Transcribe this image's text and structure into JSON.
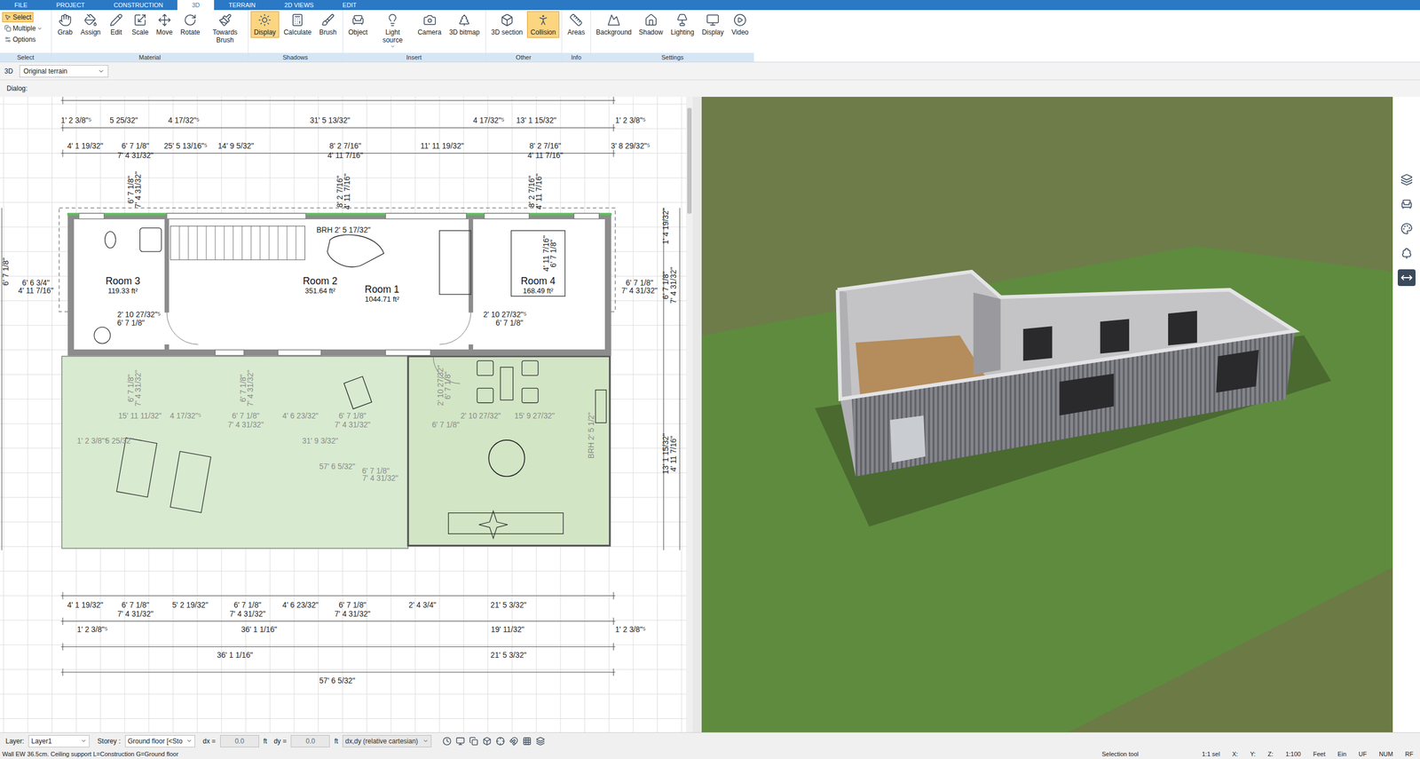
{
  "tabs": [
    {
      "label": "FILE",
      "selected": false
    },
    {
      "label": "PROJECT",
      "selected": false
    },
    {
      "label": "CONSTRUCTION",
      "selected": false
    },
    {
      "label": "3D",
      "selected": true
    },
    {
      "label": "TERRAIN",
      "selected": false
    },
    {
      "label": "2D VIEWS",
      "selected": false
    },
    {
      "label": "EDIT",
      "selected": false
    }
  ],
  "ribbon": {
    "select_group": {
      "label": "Select",
      "items": [
        {
          "label": "Select",
          "selected": true
        },
        {
          "label": "Multiple",
          "selected": false
        },
        {
          "label": "Options",
          "selected": false
        }
      ]
    },
    "groups": [
      {
        "label": "Material",
        "items": [
          {
            "label": "Grab",
            "selected": false
          },
          {
            "label": "Assign",
            "selected": false
          },
          {
            "label": "Edit",
            "selected": false
          },
          {
            "label": "Scale",
            "selected": false
          },
          {
            "label": "Move",
            "selected": false
          },
          {
            "label": "Rotate",
            "selected": false
          },
          {
            "label": "Towards Brush",
            "selected": false
          }
        ]
      },
      {
        "label": "Shadows",
        "items": [
          {
            "label": "Display",
            "selected": true
          },
          {
            "label": "Calculate",
            "selected": false
          },
          {
            "label": "Brush",
            "selected": false
          }
        ]
      },
      {
        "label": "Insert",
        "items": [
          {
            "label": "Object",
            "selected": false
          },
          {
            "label": "Light source",
            "selected": false
          },
          {
            "label": "Camera",
            "selected": false
          },
          {
            "label": "3D bitmap",
            "selected": false
          }
        ]
      },
      {
        "label": "Other",
        "items": [
          {
            "label": "3D section",
            "selected": false
          },
          {
            "label": "Collision",
            "selected": true
          }
        ]
      },
      {
        "label": "Info",
        "items": [
          {
            "label": "Areas",
            "selected": false
          }
        ]
      },
      {
        "label": "Settings",
        "items": [
          {
            "label": "Background",
            "selected": false
          },
          {
            "label": "Shadow",
            "selected": false
          },
          {
            "label": "Lighting",
            "selected": false
          },
          {
            "label": "Display",
            "selected": false
          },
          {
            "label": "Video",
            "selected": false
          }
        ]
      }
    ]
  },
  "view_bar": {
    "mode": "3D",
    "terrain": "Original terrain"
  },
  "dialog_label": "Dialog:",
  "plan": {
    "rooms": [
      {
        "name": "Room 3",
        "area": "119.33 ft²"
      },
      {
        "name": "Room 2",
        "area": "351.64 ft²"
      },
      {
        "name": "Room 1",
        "area": "1044.71 ft²"
      },
      {
        "name": "Room 4",
        "area": "168.49 ft²"
      }
    ],
    "dimensions": [
      {
        "text": "1' 2 3/8\"⁵",
        "muted": false
      },
      {
        "text": "5 25/32\"",
        "muted": false
      },
      {
        "text": "4 17/32\"⁵",
        "muted": false
      },
      {
        "text": "31' 5 13/32\"",
        "muted": false
      },
      {
        "text": "4 17/32\"⁵",
        "muted": false
      },
      {
        "text": "13' 1 15/32\"",
        "muted": false
      },
      {
        "text": "1' 2 3/8\"⁵",
        "muted": false
      },
      {
        "text": "4' 1 19/32\"",
        "muted": false
      },
      {
        "text": "6' 7 1/8\"",
        "muted": false
      },
      {
        "text": "25' 5 13/16\"⁵",
        "muted": false
      },
      {
        "text": "14' 9 5/32\"",
        "muted": false
      },
      {
        "text": "8' 2 7/16\"",
        "muted": false
      },
      {
        "text": "11' 11 19/32\"",
        "muted": false
      },
      {
        "text": "8' 2 7/16\"",
        "muted": false
      },
      {
        "text": "3' 8 29/32\"⁵",
        "muted": false
      },
      {
        "text": "7' 4 31/32\"",
        "muted": false
      },
      {
        "text": "4' 11 7/16\"",
        "muted": false
      },
      {
        "text": "4' 11 7/16\"",
        "muted": false
      },
      {
        "text": "2' 10 27/32\"⁵",
        "muted": false
      },
      {
        "text": "6' 7 1/8\"",
        "muted": false
      },
      {
        "text": "2' 10 27/32\"⁵",
        "muted": false
      },
      {
        "text": "6' 7 1/8\"",
        "muted": false
      },
      {
        "text": "6' 6 3/4\"",
        "muted": false
      },
      {
        "text": "4' 11 7/16\"",
        "muted": false
      },
      {
        "text": "6' 7 1/8\"",
        "muted": false
      },
      {
        "text": "7' 4 31/32\"",
        "muted": false
      },
      {
        "text": "15' 11 11/32\"",
        "muted": true
      },
      {
        "text": "4 17/32\"⁵",
        "muted": true
      },
      {
        "text": "6' 7 1/8\"",
        "muted": true
      },
      {
        "text": "7' 4 31/32\"",
        "muted": true
      },
      {
        "text": "4' 6 23/32\"",
        "muted": true
      },
      {
        "text": "6' 7 1/8\"",
        "muted": true
      },
      {
        "text": "7' 4 31/32\"",
        "muted": true
      },
      {
        "text": "6' 7 1/8\"",
        "muted": true
      },
      {
        "text": "2' 10 27/32\"",
        "muted": true
      },
      {
        "text": "15' 9 27/32\"",
        "muted": true
      },
      {
        "text": "1' 2 3/8\"⁵",
        "muted": true
      },
      {
        "text": "5 25/32\"",
        "muted": true
      },
      {
        "text": "31' 9 3/32\"",
        "muted": true
      },
      {
        "text": "57' 6 5/32\"",
        "muted": true
      },
      {
        "text": "6' 7 1/8\"",
        "muted": true
      },
      {
        "text": "7' 4 31/32\"",
        "muted": true
      },
      {
        "text": "4' 1 19/32\"",
        "muted": false
      },
      {
        "text": "6' 7 1/8\"",
        "muted": false
      },
      {
        "text": "5' 2 19/32\"",
        "muted": false
      },
      {
        "text": "6' 7 1/8\"",
        "muted": false
      },
      {
        "text": "4' 6 23/32\"",
        "muted": false
      },
      {
        "text": "6' 7 1/8\"",
        "muted": false
      },
      {
        "text": "2' 4 3/4\"",
        "muted": false
      },
      {
        "text": "21' 5 3/32\"",
        "muted": false
      },
      {
        "text": "7' 4 31/32\"",
        "muted": false
      },
      {
        "text": "7' 4 31/32\"",
        "muted": false
      },
      {
        "text": "7' 4 31/32\"",
        "muted": false
      },
      {
        "text": "1' 2 3/8\"⁵",
        "muted": false
      },
      {
        "text": "36' 1 1/16\"",
        "muted": false
      },
      {
        "text": "19' 11/32\"",
        "muted": false
      },
      {
        "text": "1' 2 3/8\"⁵",
        "muted": false
      },
      {
        "text": "36' 1 1/16\"",
        "muted": false
      },
      {
        "text": "21' 5 3/32\"",
        "muted": false
      },
      {
        "text": "57' 6 5/32\"",
        "muted": false
      },
      {
        "text": "BRH  2' 5 17/32\"",
        "muted": false
      }
    ],
    "vertical_dimensions": [
      {
        "text": "6' 7 1/8\"",
        "muted": false
      },
      {
        "text": "7' 4 31/32\"",
        "muted": false
      },
      {
        "text": "8' 2 7/16\"",
        "muted": false
      },
      {
        "text": "4' 11 7/16\"",
        "muted": false
      },
      {
        "text": "8' 2 7/16\"",
        "muted": false
      },
      {
        "text": "4' 11 7/16\"",
        "muted": false
      },
      {
        "text": "4' 11 7/16\"",
        "muted": false
      },
      {
        "text": "6' 7 1/8\"",
        "muted": false
      },
      {
        "text": "6' 7 1/8\"",
        "muted": true
      },
      {
        "text": "7' 4 31/32\"",
        "muted": true
      },
      {
        "text": "6' 7 1/8\"",
        "muted": true
      },
      {
        "text": "7' 4 31/32\"",
        "muted": true
      },
      {
        "text": "2' 10 27/32\"",
        "muted": true
      },
      {
        "text": "6' 7 1/8\"",
        "muted": true
      },
      {
        "text": "1' 4 19/32\"",
        "muted": false
      },
      {
        "text": "6' 7 1/8\"",
        "muted": false
      },
      {
        "text": "7' 4 31/32\"",
        "muted": false
      },
      {
        "text": "13' 1 15/32\"",
        "muted": false
      },
      {
        "text": "4' 11 7/16\"",
        "muted": false
      },
      {
        "text": "6' 7 1/8\"",
        "muted": false
      },
      {
        "text": "BRH 2' 5 1/2\"",
        "muted": true
      }
    ]
  },
  "status_bar": {
    "layer_label": "Layer:",
    "layer": "Layer1",
    "storey_label": "Storey :",
    "storey": "Ground floor [<Sto",
    "dx_label": "dx =",
    "dx": "0.0",
    "dx_unit": "ft",
    "dy_label": "dy =",
    "dy": "0.0",
    "dy_unit": "ft",
    "coord_mode": "dx,dy (relative cartesian)"
  },
  "info_bar": {
    "message": "Wall EW 36.5cm. Ceiling support L=Construction G=Ground floor",
    "tool": "Selection tool",
    "fields": [
      "1:1 sel",
      "X:",
      "Y:",
      "Z:",
      "1:100",
      "Feet",
      "Ein",
      "UF",
      "NUM",
      "RF"
    ]
  }
}
